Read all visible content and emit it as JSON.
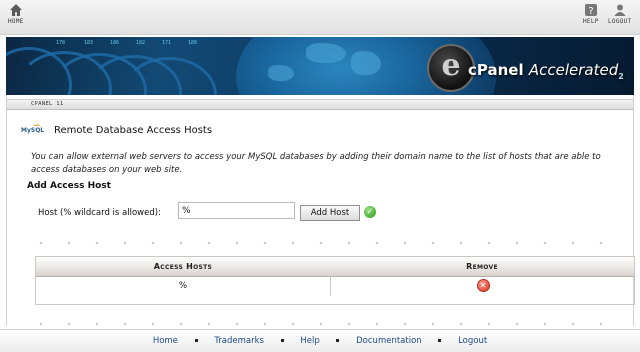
{
  "toolbar": {
    "home_label": "HOME",
    "help_label": "HELP",
    "logout_label": "LOGOUT"
  },
  "banner": {
    "brand_letter": "e",
    "brand_name": "cPanel",
    "brand_suffix": "Accelerated",
    "brand_version": "2",
    "scroll_numbers": [
      "178",
      "183",
      "186",
      "182",
      "171",
      "180"
    ]
  },
  "breadcrumb": "CPANEL 11",
  "page": {
    "mysql_icon_text": "MySQL",
    "title": "Remote Database Access Hosts",
    "description": "You can allow external web servers to access your MySQL databases by adding their domain name to the list of hosts that are able to access databases on your web site.",
    "section_title": "Add Access Host",
    "host_label": "Host (% wildcard is allowed):",
    "host_value": "%",
    "add_button": "Add Host"
  },
  "table": {
    "headers": [
      "Access Hosts",
      "Remove"
    ],
    "rows": [
      {
        "host": "%"
      }
    ]
  },
  "footer": {
    "links": [
      "Home",
      "Trademarks",
      "Help",
      "Documentation",
      "Logout"
    ]
  },
  "colors": {
    "link": "#1a4b8a",
    "banner": "#0e3a63",
    "ok": "#2e9b1c",
    "remove": "#d93324"
  }
}
